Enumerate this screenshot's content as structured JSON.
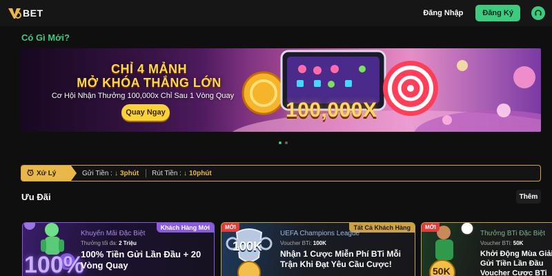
{
  "header": {
    "logo_text": "BET",
    "login_label": "Đăng Nhập",
    "register_label": "Đăng Ký"
  },
  "whats_new": {
    "title": "Có Gì Mới?"
  },
  "banner": {
    "headline_1": "CHỈ 4 MẢNH",
    "headline_2": "MỞ KHÓA THẮNG LỚN",
    "subtitle": "Cơ Hội Nhận Thưởng 100,000x Chỉ Sau 1 Vòng Quay",
    "cta_label": "Quay Ngay",
    "amount": "100,000X",
    "slide_count": 2,
    "active_slide": 1
  },
  "processing": {
    "tag_label": "Xử Lý",
    "deposit_label": "Gửi Tiền :",
    "deposit_value": "3phút",
    "withdraw_label": "Rút Tiền :",
    "withdraw_value": "10phút"
  },
  "offers": {
    "title": "Ưu Đãi",
    "more_label": "Thêm",
    "cards": [
      {
        "badge": "Khách Hàng Mới",
        "category": "Khuyến Mãi Đặc Biệt",
        "limit_label": "Thưởng tối đa:",
        "limit_value": "2 Triệu",
        "title": "100% Tiền Gửi Lần Đầu + 20 Vòng Quay",
        "art_text": "100%"
      },
      {
        "new_tag": "MỚI",
        "badge": "Tất Cả Khách Hàng",
        "category": "UEFA Champions League",
        "limit_label": "Voucher BTi:",
        "limit_value": "100K",
        "title": "Nhận 1 Cược Miễn Phí BTi Mỗi Trận Khi Đạt Yêu Cầu Cược!",
        "art_text": "100K"
      },
      {
        "new_tag": "MỚI",
        "category": "Thưởng BTi Đặc Biệt",
        "limit_label": "Voucher BTi:",
        "limit_value": "50K",
        "title": "Khởi Động Mùa Giải Gửi Tiền Lần Đầu Voucher Cược BTi",
        "art_text": "50K"
      }
    ]
  },
  "colors": {
    "accent_green": "#3ecb7f",
    "gold": "#e8b84a",
    "purple": "#8a5ae0"
  }
}
